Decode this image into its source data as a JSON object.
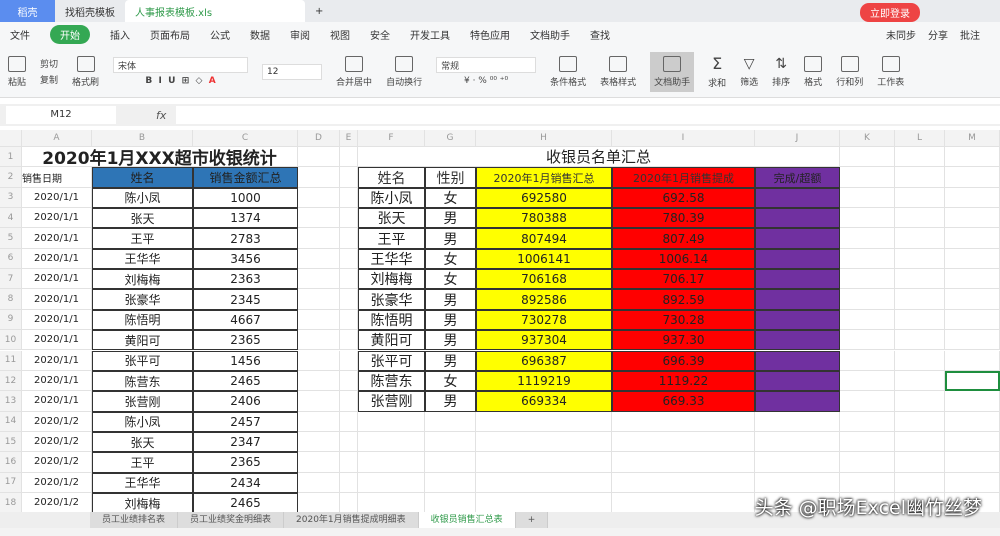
{
  "tabs": [
    "稻壳",
    "找稻壳模板",
    "人事报表模板.xls"
  ],
  "login": "立即登录",
  "menu": [
    "文件",
    "开始",
    "插入",
    "页面布局",
    "公式",
    "数据",
    "审阅",
    "视图",
    "安全",
    "开发工具",
    "特色应用",
    "文档助手",
    "查找"
  ],
  "menu_right": [
    "未同步",
    "分享",
    "批注"
  ],
  "ribbon": {
    "paste": "粘贴",
    "cut": "剪切",
    "copy": "复制",
    "brush": "格式刷",
    "font": "宋体",
    "size": "12",
    "merge": "合并居中",
    "wrap": "自动换行",
    "numfmt": "常规",
    "cond": "条件格式",
    "tstyle": "表格样式",
    "assist": "文档助手",
    "sum": "求和",
    "filter": "筛选",
    "sort": "排序",
    "format": "格式",
    "rowcol": "行和列",
    "sheet": "工作表"
  },
  "namebox": "M12",
  "fx": "fx",
  "columns": [
    "A",
    "B",
    "C",
    "D",
    "E",
    "F",
    "G",
    "H",
    "I",
    "J",
    "K",
    "L",
    "M"
  ],
  "left": {
    "title": "2020年1月XXX超市收银统计",
    "headers": [
      "销售日期",
      "姓名",
      "销售金额汇总"
    ],
    "rows": [
      [
        "2020/1/1",
        "陈小凤",
        "1000"
      ],
      [
        "2020/1/1",
        "张天",
        "1374"
      ],
      [
        "2020/1/1",
        "王平",
        "2783"
      ],
      [
        "2020/1/1",
        "王华华",
        "3456"
      ],
      [
        "2020/1/1",
        "刘梅梅",
        "2363"
      ],
      [
        "2020/1/1",
        "张豪华",
        "2345"
      ],
      [
        "2020/1/1",
        "陈悟明",
        "4667"
      ],
      [
        "2020/1/1",
        "黄阳可",
        "2365"
      ],
      [
        "2020/1/1",
        "张平可",
        "1456"
      ],
      [
        "2020/1/1",
        "陈营东",
        "2465"
      ],
      [
        "2020/1/1",
        "张营刚",
        "2406"
      ],
      [
        "2020/1/2",
        "陈小凤",
        "2457"
      ],
      [
        "2020/1/2",
        "张天",
        "2347"
      ],
      [
        "2020/1/2",
        "王平",
        "2365"
      ],
      [
        "2020/1/2",
        "王华华",
        "2434"
      ],
      [
        "2020/1/2",
        "刘梅梅",
        "2465"
      ]
    ]
  },
  "right": {
    "title": "收银员名单汇总",
    "headers": [
      "姓名",
      "性别",
      "2020年1月销售汇总",
      "2020年1月销售提成",
      "完成/超额"
    ],
    "rows": [
      [
        "陈小凤",
        "女",
        "692580",
        "692.58",
        ""
      ],
      [
        "张天",
        "男",
        "780388",
        "780.39",
        ""
      ],
      [
        "王平",
        "男",
        "807494",
        "807.49",
        ""
      ],
      [
        "王华华",
        "女",
        "1006141",
        "1006.14",
        ""
      ],
      [
        "刘梅梅",
        "女",
        "706168",
        "706.17",
        ""
      ],
      [
        "张豪华",
        "男",
        "892586",
        "892.59",
        ""
      ],
      [
        "陈悟明",
        "男",
        "730278",
        "730.28",
        ""
      ],
      [
        "黄阳可",
        "男",
        "937304",
        "937.30",
        ""
      ],
      [
        "张平可",
        "男",
        "696387",
        "696.39",
        ""
      ],
      [
        "陈营东",
        "女",
        "1119219",
        "1119.22",
        ""
      ],
      [
        "张营刚",
        "男",
        "669334",
        "669.33",
        ""
      ]
    ]
  },
  "colors": {
    "blue": "#2e75b6",
    "yellow": "#ffff00",
    "red": "#ff0000",
    "purple": "#7030a0"
  },
  "sheets": [
    "员工业绩排名表",
    "员工业绩奖金明细表",
    "2020年1月销售提成明细表",
    "收银员销售汇总表"
  ],
  "watermark": "头条 @职场Excel幽竹丝梦"
}
